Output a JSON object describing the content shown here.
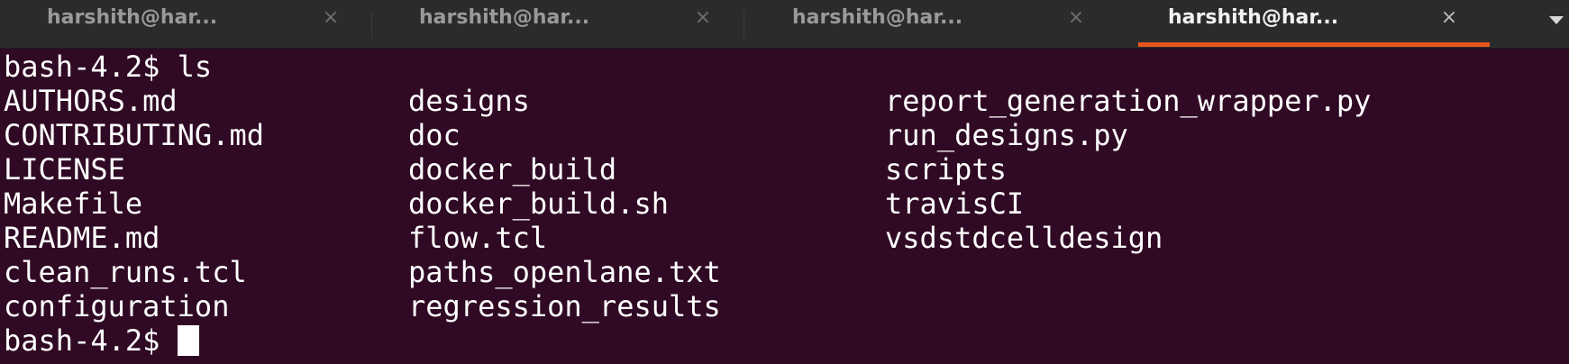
{
  "tabs": [
    {
      "title": "harshith@har...",
      "close": "×",
      "active": false
    },
    {
      "title": "harshith@har...",
      "close": "×",
      "active": false
    },
    {
      "title": "harshith@har...",
      "close": "×",
      "active": false
    },
    {
      "title": "harshith@har...",
      "close": "×",
      "active": true
    }
  ],
  "terminal": {
    "prompt_line": "bash-4.2$ ls",
    "listing": {
      "col1": [
        "AUTHORS.md",
        "CONTRIBUTING.md",
        "LICENSE",
        "Makefile",
        "README.md",
        "clean_runs.tcl",
        "configuration"
      ],
      "col2": [
        "designs",
        "doc",
        "docker_build",
        "docker_build.sh",
        "flow.tcl",
        "paths_openlane.txt",
        "regression_results"
      ],
      "col3": [
        "report_generation_wrapper.py",
        "run_designs.py",
        "scripts",
        "travisCI",
        "vsdstdcelldesign"
      ]
    },
    "current_prompt": "bash-4.2$ "
  },
  "colors": {
    "background": "#300a24",
    "tabbar": "#2b2b2b",
    "accent": "#e95420",
    "text": "#ffffff"
  }
}
